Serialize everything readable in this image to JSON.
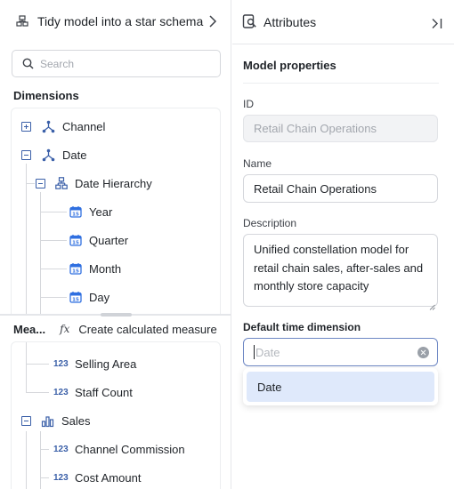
{
  "left_panel": {
    "model_title": "Tidy model into a star schema",
    "search_placeholder": "Search",
    "dimensions_label": "Dimensions",
    "dimensions": [
      {
        "label": "Channel",
        "icon": "hierarchy-icon",
        "state": "collapsed"
      },
      {
        "label": "Date",
        "icon": "hierarchy-icon",
        "state": "expanded"
      },
      {
        "label": "Date Hierarchy",
        "icon": "org-chart-icon",
        "state": "expanded"
      },
      {
        "label": "Year",
        "icon": "calendar-icon"
      },
      {
        "label": "Quarter",
        "icon": "calendar-icon"
      },
      {
        "label": "Month",
        "icon": "calendar-icon"
      },
      {
        "label": "Day",
        "icon": "calendar-icon"
      }
    ],
    "measures_label": "Mea...",
    "create_calc_icon": "fx",
    "create_calc_label": "Create calculated measure",
    "measures": [
      {
        "label": "Selling Area",
        "type": "123"
      },
      {
        "label": "Staff Count",
        "type": "123"
      },
      {
        "label": "Sales",
        "icon": "bar-chart-icon",
        "state": "expanded"
      },
      {
        "label": "Channel Commission",
        "type": "123"
      },
      {
        "label": "Cost Amount",
        "type": "123"
      }
    ]
  },
  "right_panel": {
    "title": "Attributes",
    "section": "Model properties",
    "id_label": "ID",
    "id_value": "Retail Chain Operations",
    "name_label": "Name",
    "name_value": "Retail Chain Operations",
    "description_label": "Description",
    "description_lines": [
      "Unified constellation model for",
      "retail chain sales, after-sales and",
      "monthly store capacity"
    ],
    "time_dim_label": "Default time dimension",
    "time_dim_placeholder": "Date",
    "dropdown_options": [
      "Date"
    ]
  },
  "colors": {
    "accent": "#3a5fa8",
    "calendar_blue": "#2f6fe0",
    "selected_option_bg": "#dfe9fb",
    "border": "#d5d7dc"
  }
}
